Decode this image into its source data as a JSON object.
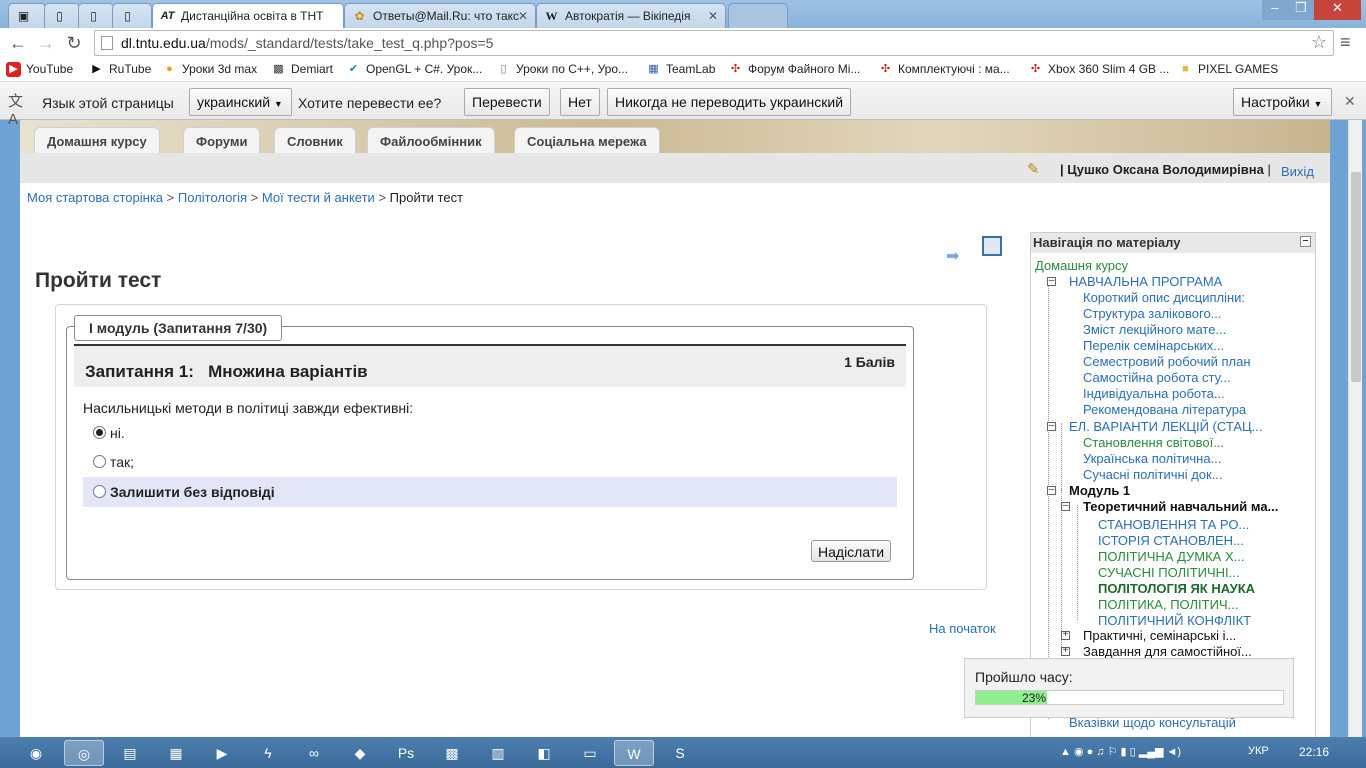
{
  "browser": {
    "tabs": [
      {
        "label": "Дистанційна освіта в ТНТ",
        "icon": "AT",
        "active": true
      },
      {
        "label": "Ответы@Mail.Ru: что такс",
        "icon": "mail-ru-icon",
        "active": false
      },
      {
        "label": "Автократія — Вікіпедія",
        "icon": "W",
        "active": false
      }
    ],
    "url": {
      "host": "dl.tntu.edu.ua",
      "path": "/mods/_standard/tests/take_test_q.php?pos=5"
    },
    "bookmarks": [
      "YouTube",
      "RuTube",
      "Уроки 3d max",
      "Demiart",
      "OpenGL + C#. Урок...",
      "Уроки по C++, Уро...",
      "TeamLab",
      "Форум Файного Мі...",
      "Комплектуючі : ма...",
      "Xbox 360 Slim 4 GB ...",
      "PIXEL GAMES"
    ]
  },
  "translate_bar": {
    "prompt": "Язык этой страницы",
    "language": "украинский",
    "question": "Хотите перевести ее?",
    "translate_btn": "Перевести",
    "no_btn": "Нет",
    "never_btn": "Никогда не переводить украинский",
    "settings_btn": "Настройки"
  },
  "course_tabs": [
    "Домашня курсу",
    "Форуми",
    "Словник",
    "Файлообмінник",
    "Соціальна мережа"
  ],
  "user": {
    "name": "Цушко Оксана Володимирівна",
    "separator": "|",
    "logout": "Вихід"
  },
  "breadcrumb": {
    "items": [
      "Моя стартова сторінка",
      "Політологія",
      "Мої тести й анкети"
    ],
    "current": "Пройти тест",
    "sep": ">"
  },
  "page_title": "Пройти тест",
  "quiz": {
    "legend": "І модуль (Запитання 7/30)",
    "question_title": "Запитання 1:   Множина варіантів",
    "points": "1 Балів",
    "question_text": "Насильницькі методи в політиці завжди ефективні:",
    "options": [
      {
        "label": "ні.",
        "selected": true
      },
      {
        "label": "так;",
        "selected": false
      },
      {
        "label": "Залишити без відповіді",
        "selected": false
      }
    ],
    "submit": "Надіслати",
    "to_top": "На початок"
  },
  "nav": {
    "title": "Навігація по матеріалу",
    "home": "Домашня курсу",
    "items": [
      "НАВЧАЛЬНА ПРОГРАМА",
      "Короткий опис дисципліни:",
      "Структура залікового...",
      "Зміст лекційного мате...",
      "Перелік семінарських...",
      "Семестровий робочий план",
      "Самостійна робота сту...",
      "Індивідуальна робота...",
      "Рекомендована література",
      "ЕЛ. ВАРІАНТИ ЛЕКЦІЙ (СТАЦ...",
      "Становлення світової...",
      "Українська політична...",
      "Сучасні політичні док...",
      "Модуль 1",
      "Теоретичний навчальний ма...",
      "СТАНОВЛЕННЯ ТА РО...",
      "ІСТОРІЯ СТАНОВЛЕН...",
      "ПОЛІТИЧНА ДУМКА Х...",
      "СУЧАСНІ ПОЛІТИЧНІ...",
      "ПОЛІТОЛОГІЯ ЯК НАУКА",
      "ПОЛІТИКА, ПОЛІТИЧ...",
      "ПОЛІТИЧНИЙ КОНФЛІКТ",
      "Практичні, семінарські і...",
      "Завдання для самостійної...",
      "Вказівки щодо консультацій"
    ]
  },
  "timer": {
    "label": "Пройшло часу:",
    "percent_text": "23%",
    "fraction": 0.23
  },
  "taskbar": {
    "lang": "УКР",
    "clock": "22:16"
  }
}
